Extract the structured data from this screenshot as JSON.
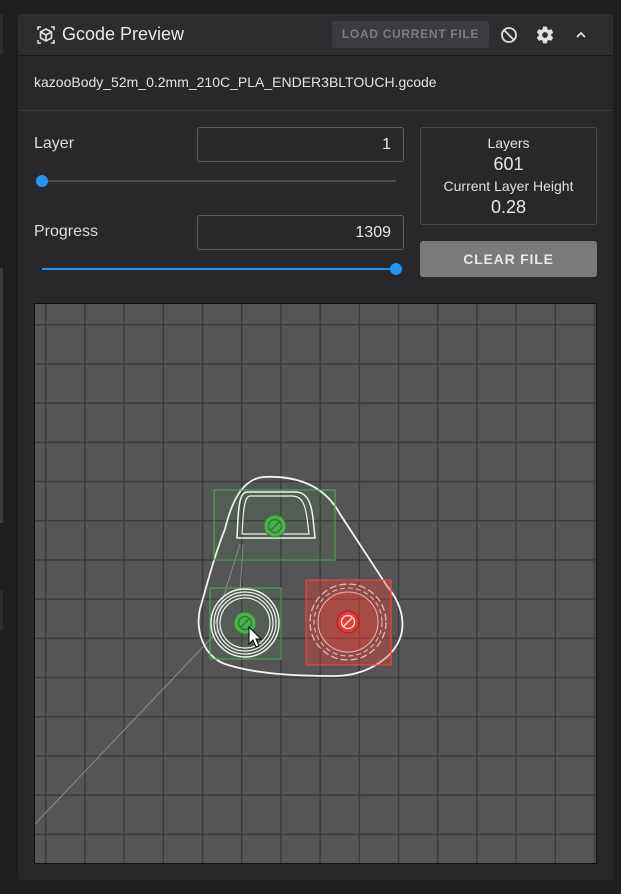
{
  "header": {
    "title": "Gcode Preview",
    "load_button": "LOAD CURRENT FILE",
    "icons": [
      "cube-logo-icon",
      "cancel-icon",
      "gear-icon",
      "chevron-up-icon"
    ]
  },
  "file": {
    "name": "kazooBody_52m_0.2mm_210C_PLA_ENDER3BLTOUCH.gcode"
  },
  "layer": {
    "label": "Layer",
    "value": "1",
    "slider_fraction": 0.0
  },
  "progress": {
    "label": "Progress",
    "value": "1309",
    "slider_fraction": 1.0
  },
  "info": {
    "layers_label": "Layers",
    "layers_value": "601",
    "height_label": "Current Layer Height",
    "height_value": "0.28"
  },
  "clear_button": "CLEAR FILE",
  "colors": {
    "accent": "#2196f3",
    "included_object": "#4caf50",
    "excluded_object": "#f44336",
    "bed": "#555557",
    "toolpath": "#ffffff"
  }
}
